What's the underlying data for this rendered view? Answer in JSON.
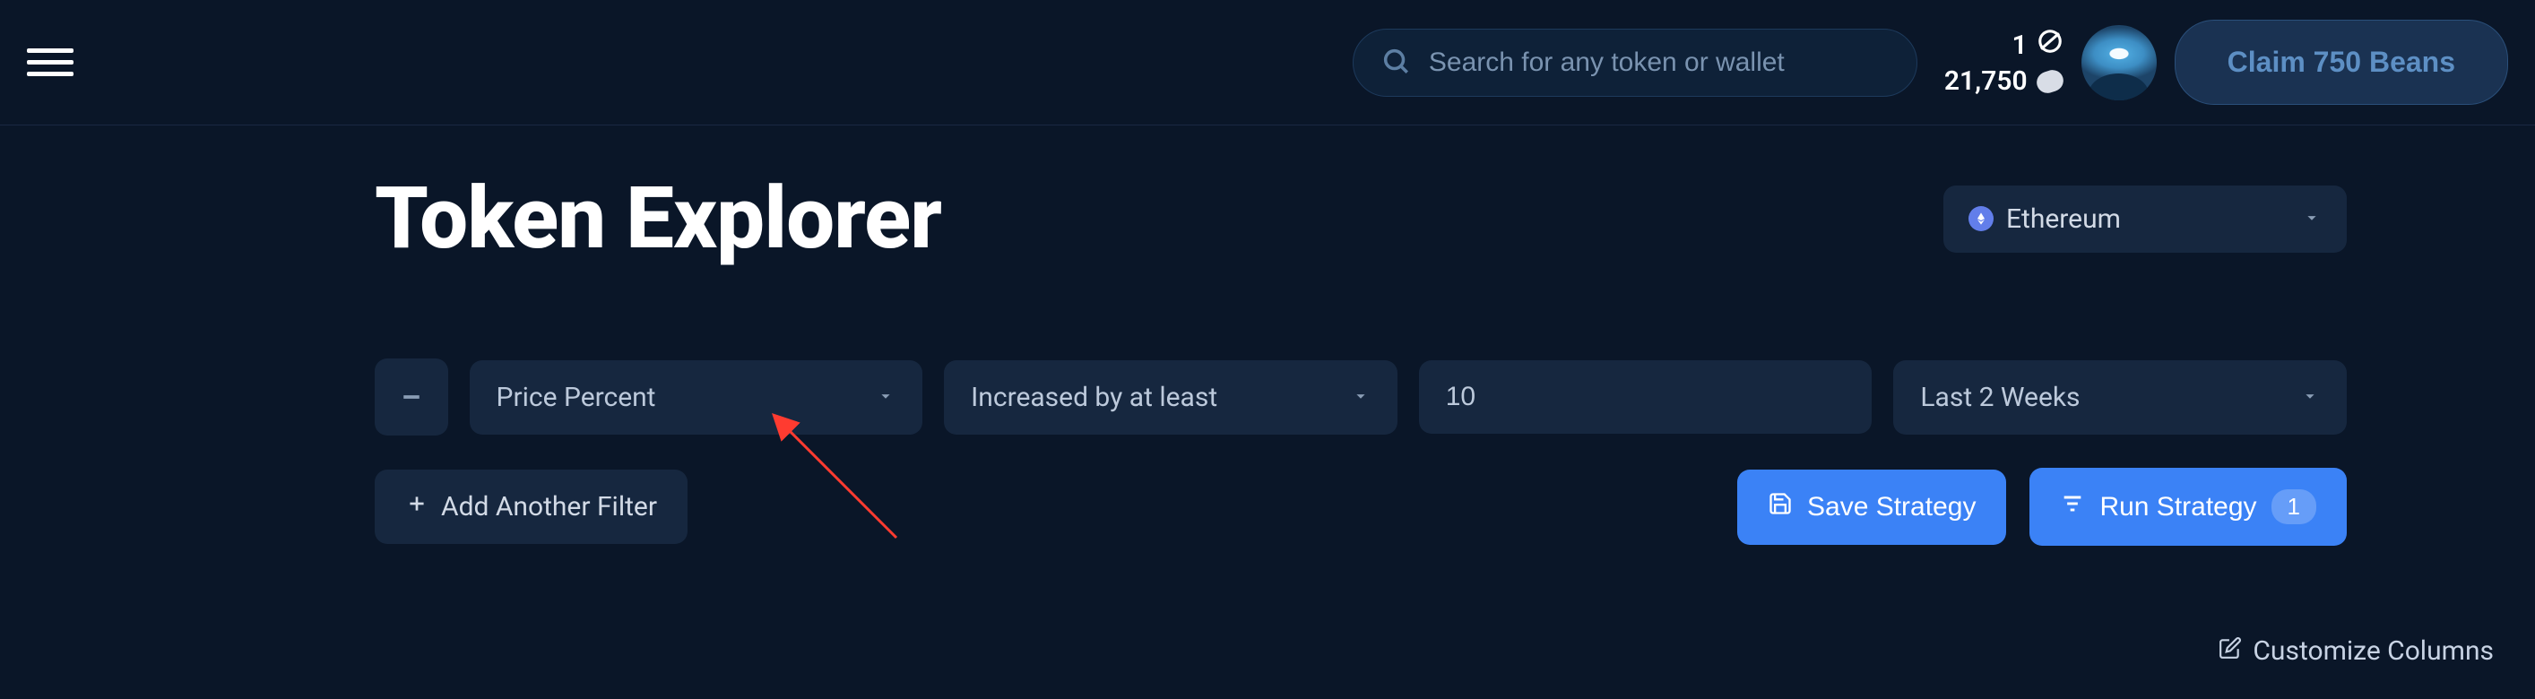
{
  "header": {
    "search_placeholder": "Search for any token or wallet",
    "stat_top_value": "1",
    "stat_bottom_value": "21,750",
    "claim_label": "Claim 750 Beans"
  },
  "page": {
    "title": "Token Explorer",
    "network_label": "Ethereum"
  },
  "filter": {
    "metric": "Price Percent",
    "condition": "Increased by at least",
    "value": "10",
    "period": "Last 2 Weeks"
  },
  "actions": {
    "add_filter_label": "Add Another Filter",
    "save_label": "Save Strategy",
    "run_label": "Run Strategy",
    "run_badge": "1"
  },
  "footer": {
    "customize_label": "Customize Columns"
  }
}
